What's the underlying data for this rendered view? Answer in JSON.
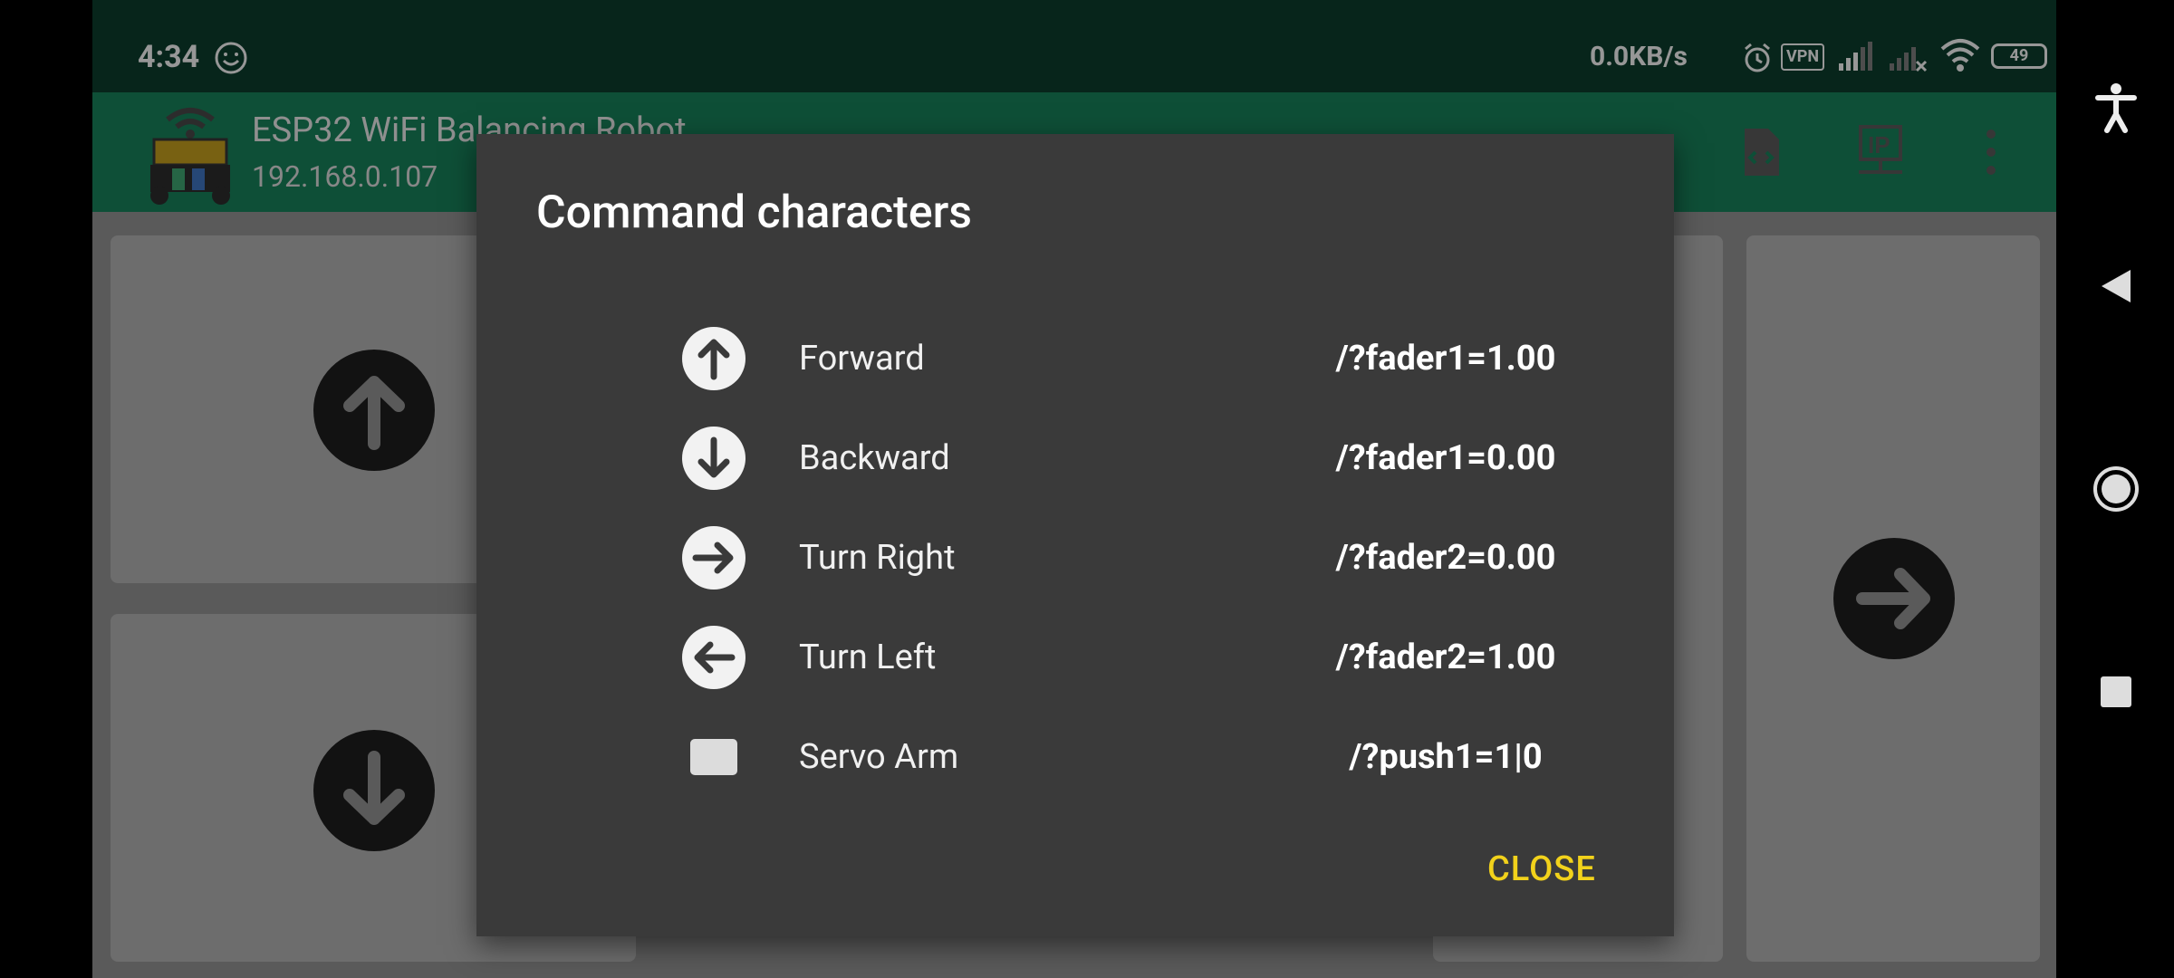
{
  "status_bar": {
    "time": "4:34",
    "net_speed": "0.0KB/s",
    "vpn_label": "VPN",
    "battery_level": "49"
  },
  "app_bar": {
    "title": "ESP32 WiFi Balancing Robot",
    "subtitle": "192.168.0.107"
  },
  "dialog": {
    "title": "Command characters",
    "rows": [
      {
        "icon": "arrow-up-icon",
        "label": "Forward",
        "command": "/?fader1=1.00"
      },
      {
        "icon": "arrow-down-icon",
        "label": "Backward",
        "command": "/?fader1=0.00"
      },
      {
        "icon": "arrow-right-icon",
        "label": "Turn Right",
        "command": "/?fader2=0.00"
      },
      {
        "icon": "arrow-left-icon",
        "label": "Turn Left",
        "command": "/?fader2=1.00"
      },
      {
        "icon": "square-icon",
        "label": "Servo Arm",
        "command": "/?push1=1|0"
      }
    ],
    "close_label": "CLOSE"
  },
  "colors": {
    "status_bar_bg": "#0b3a2a",
    "app_bar_bg": "#167a55",
    "dialog_bg": "#3a3a3a",
    "accent": "#f2d21b"
  }
}
